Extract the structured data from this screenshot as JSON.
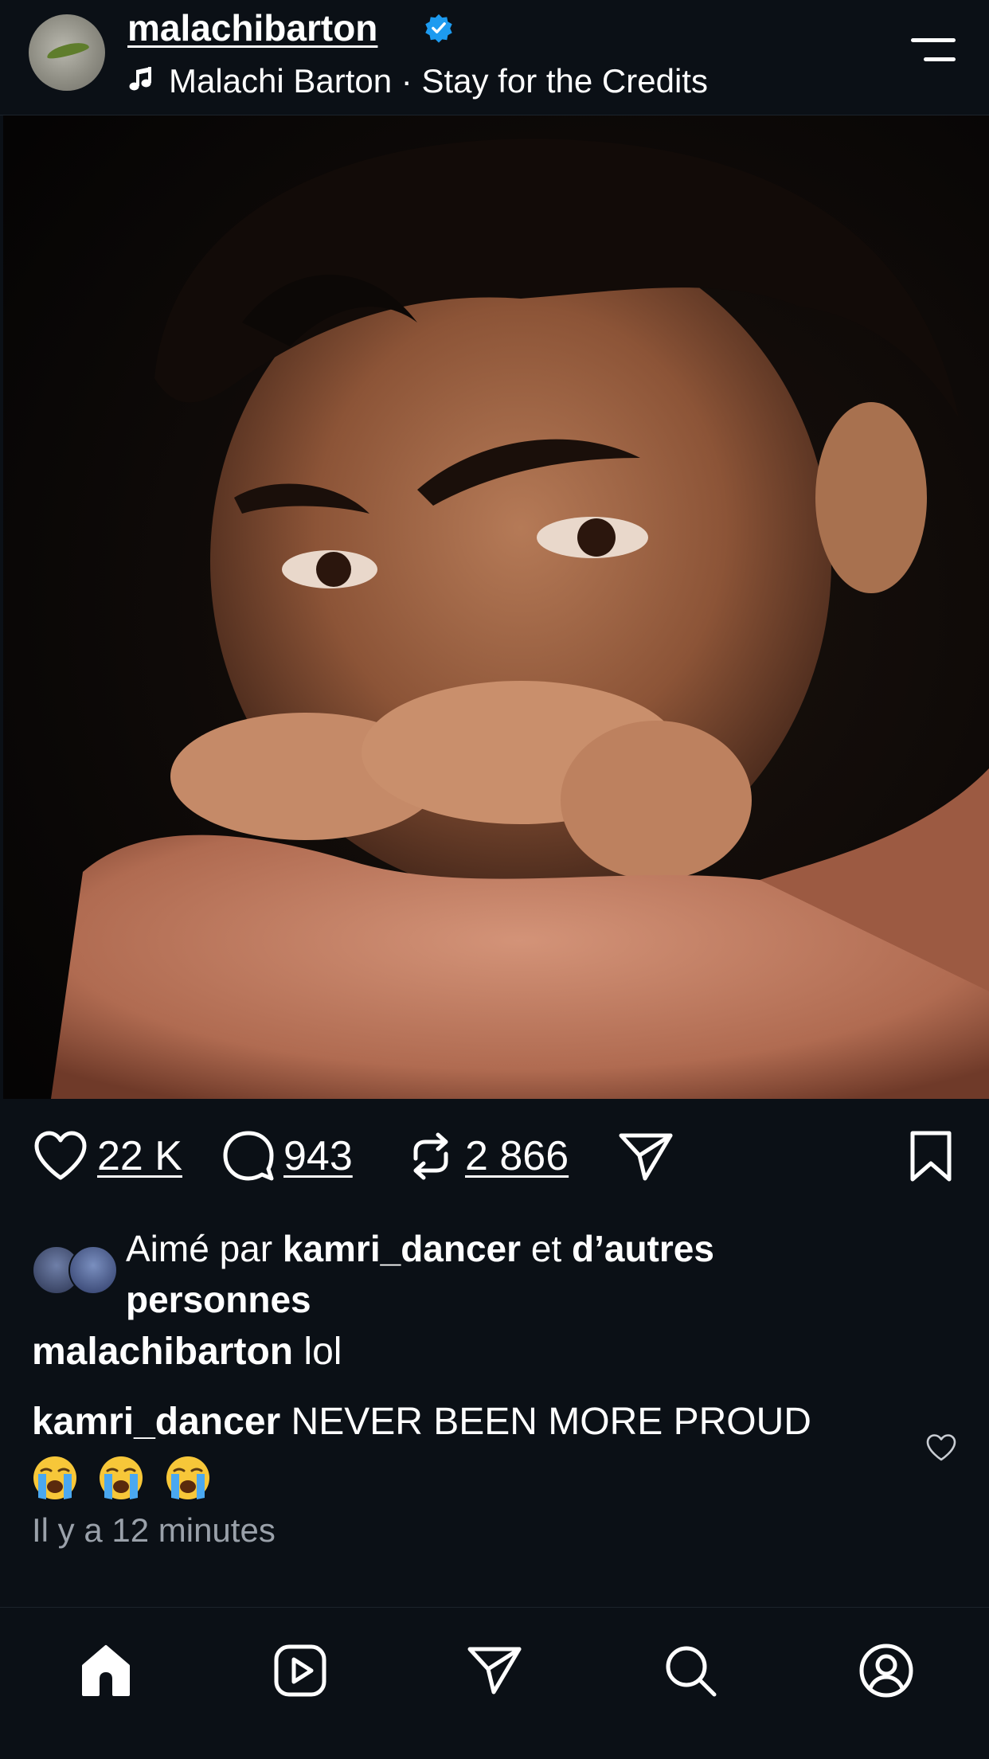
{
  "post": {
    "username": "malachibarton",
    "audio": "Malachi Barton · Stay for the Credits"
  },
  "actions": {
    "likes": "22 K",
    "comments": "943",
    "reposts": "2 866"
  },
  "liked_by": {
    "prefix": "Aimé par",
    "user": "kamri_dancer",
    "conjunction": "et",
    "others": "d’autres personnes"
  },
  "caption": {
    "username": "malachibarton",
    "text": "lol"
  },
  "top_comment": {
    "username": "kamri_dancer",
    "text": "NEVER BEEN MORE PROUD"
  },
  "timestamp": "Il y a 12 minutes",
  "colors": {
    "background": "#0b1016",
    "verified": "#1d9bf0",
    "muted_text": "#9aa1aa"
  },
  "icons": {
    "menu": "menu-icon",
    "mute": "mute-icon",
    "like": "heart-icon",
    "comment": "comment-icon",
    "repost": "repost-icon",
    "share": "send-icon",
    "save": "bookmark-icon",
    "tabs": [
      "home-icon",
      "reels-icon",
      "send-icon",
      "search-icon",
      "profile-icon"
    ]
  }
}
